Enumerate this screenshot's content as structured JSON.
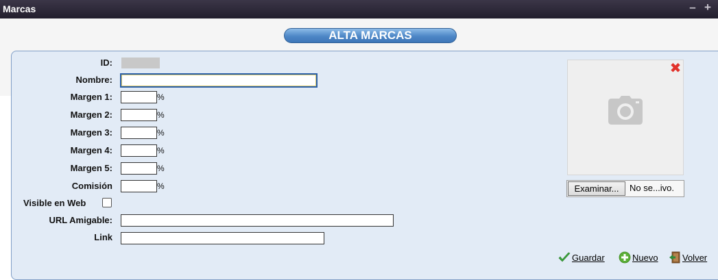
{
  "window": {
    "title": "Marcas"
  },
  "heading": "ALTA MARCAS",
  "form": {
    "id_label": "ID:",
    "nombre_label": "Nombre:",
    "nombre_value": "",
    "margen1_label": "Margen 1:",
    "margen2_label": "Margen 2:",
    "margen3_label": "Margen 3:",
    "margen4_label": "Margen 4:",
    "margen5_label": "Margen 5:",
    "comision_label": "Comisión",
    "percent": "%",
    "visible_label": "Visible en Web",
    "url_label": "URL Amigable:",
    "link_label": "Link"
  },
  "image": {
    "browse_label": "Examinar...",
    "file_status": "No se...ivo."
  },
  "actions": {
    "guardar": "Guardar",
    "nuevo": "Nuevo",
    "volver": "Volver"
  },
  "colors": {
    "titlebar": "#221e2d",
    "panel_bg": "#e2ebf6",
    "heading_bg": "#4d87c6",
    "delete_red": "#e2322b",
    "guardar_green": "#3aa63a"
  }
}
